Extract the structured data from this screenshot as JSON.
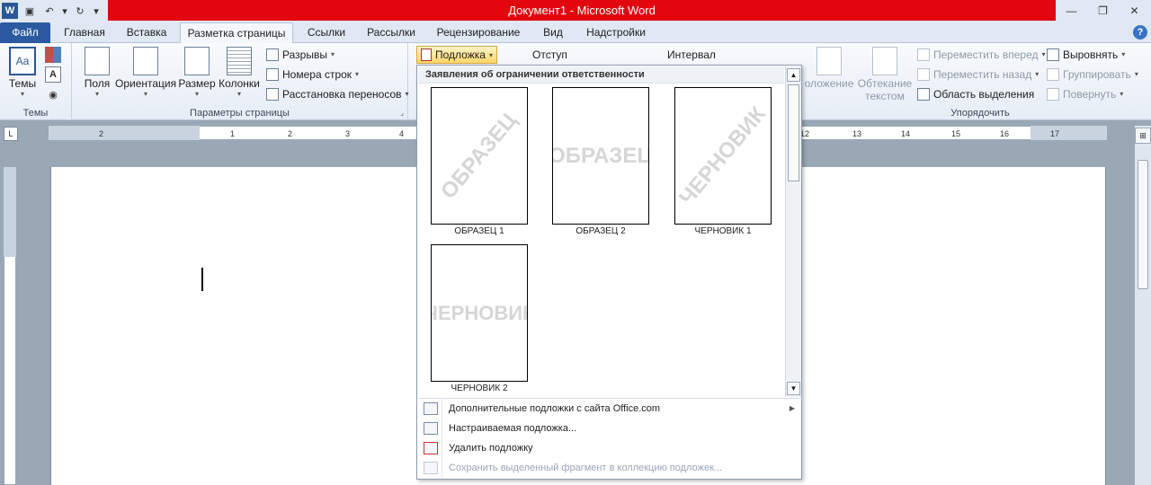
{
  "window": {
    "title": "Документ1 - Microsoft Word",
    "title_bar_color": "#e2060e"
  },
  "tabs": [
    "Файл",
    "Главная",
    "Вставка",
    "Разметка страницы",
    "Ссылки",
    "Рассылки",
    "Рецензирование",
    "Вид",
    "Надстройки"
  ],
  "active_tab": "Разметка страницы",
  "ribbon": {
    "themes": {
      "group_label": "Темы",
      "themes_btn": "Темы"
    },
    "page_setup": {
      "group_label": "Параметры страницы",
      "margins": "Поля",
      "orientation": "Ориентация",
      "size": "Размер",
      "columns": "Колонки",
      "breaks": "Разрывы",
      "line_numbers": "Номера строк",
      "hyphenation": "Расстановка переносов"
    },
    "paragraph": {
      "watermark": "Подложка",
      "indent": "Отступ",
      "spacing": "Интервал"
    },
    "arrange": {
      "group_label": "Упорядочить",
      "position_partial": "оложение",
      "wrap_text": "Обтекание текстом",
      "bring_forward": "Переместить вперед",
      "send_backward": "Переместить назад",
      "selection_pane": "Область выделения",
      "align": "Выровнять",
      "group": "Группировать",
      "rotate": "Повернуть"
    }
  },
  "ruler": {
    "left_numbers": [
      "1",
      "2",
      "1",
      "2",
      "3",
      "4"
    ],
    "right_numbers": [
      "12",
      "13",
      "14",
      "15",
      "16",
      "17"
    ]
  },
  "watermark_gallery": {
    "section_header": "Заявления об ограничении ответственности",
    "items": [
      {
        "label": "ОБРАЗЕЦ 1",
        "watermark_text": "ОБРАЗЕЦ",
        "orientation": "diagonal"
      },
      {
        "label": "ОБРАЗЕЦ 2",
        "watermark_text": "ОБРАЗЕЦ",
        "orientation": "horizontal"
      },
      {
        "label": "ЧЕРНОВИК 1",
        "watermark_text": "ЧЕРНОВИК",
        "orientation": "diagonal"
      },
      {
        "label": "ЧЕРНОВИК 2",
        "watermark_text": "ЧЕРНОВИК",
        "orientation": "horizontal"
      }
    ],
    "menu": [
      {
        "label": "Дополнительные подложки с сайта Office.com",
        "enabled": true,
        "submenu": true
      },
      {
        "label": "Настраиваемая подложка...",
        "enabled": true,
        "submenu": false
      },
      {
        "label": "Удалить подложку",
        "enabled": true,
        "submenu": false
      },
      {
        "label": "Сохранить выделенный фрагмент в коллекцию подложек...",
        "enabled": false,
        "submenu": false
      }
    ]
  }
}
